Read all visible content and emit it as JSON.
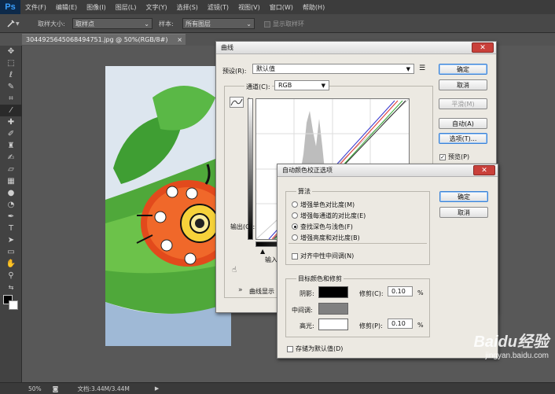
{
  "app": {
    "logo": "Ps"
  },
  "menu": [
    "文件(F)",
    "编辑(E)",
    "图像(I)",
    "图层(L)",
    "文字(Y)",
    "选择(S)",
    "滤镜(T)",
    "视图(V)",
    "窗口(W)",
    "帮助(H)"
  ],
  "options": {
    "sample_size_label": "取样大小:",
    "sample_size_value": "取样点",
    "sample_label": "样本:",
    "sample_value": "所有图层",
    "show_ring_label": "显示取样环"
  },
  "document_tab": {
    "title": "3044925645068494751.jpg @ 50%(RGB/8#)",
    "close": "×"
  },
  "status": {
    "zoom": "50%",
    "doc_info": "文档:3.44M/3.44M"
  },
  "curves": {
    "title": "曲线",
    "preset_label": "预设(R):",
    "preset_value": "默认值",
    "channel_label": "通道(C):",
    "channel_value": "RGB",
    "output_label": "输出(O):",
    "input_label": "输入",
    "display_options_label": "曲线显示",
    "buttons": {
      "ok": "确定",
      "cancel": "取消",
      "smooth": "平滑(M)",
      "auto": "自动(A)",
      "options": "选项(T)..."
    },
    "preview_label": "预览(P)",
    "preview_checked": true
  },
  "auto_color": {
    "title": "自动颜色校正选项",
    "algorithms_title": "算法",
    "algorithms": [
      {
        "label": "增强单色对比度(M)",
        "selected": false
      },
      {
        "label": "增强每通道的对比度(E)",
        "selected": false
      },
      {
        "label": "查找深色与浅色(F)",
        "selected": true
      },
      {
        "label": "增强亮度和对比度(B)",
        "selected": false
      }
    ],
    "snap_neutral_label": "对齐中性中间调(N)",
    "targets_title": "目标颜色和修剪",
    "shadows_label": "阴影:",
    "midtones_label": "中间调:",
    "highlights_label": "高光:",
    "clip_shadow_label": "修剪(C):",
    "clip_shadow_value": "0.10",
    "clip_highlight_label": "修剪(P):",
    "clip_highlight_value": "0.10",
    "percent": "%",
    "save_default_label": "存储为默认值(D)",
    "buttons": {
      "ok": "确定",
      "cancel": "取消"
    },
    "colors": {
      "shadow": "#000000",
      "midtone": "#808080",
      "highlight": "#ffffff"
    }
  },
  "watermark": {
    "brand": "Baidu经验",
    "url": "jingyan.baidu.com"
  }
}
